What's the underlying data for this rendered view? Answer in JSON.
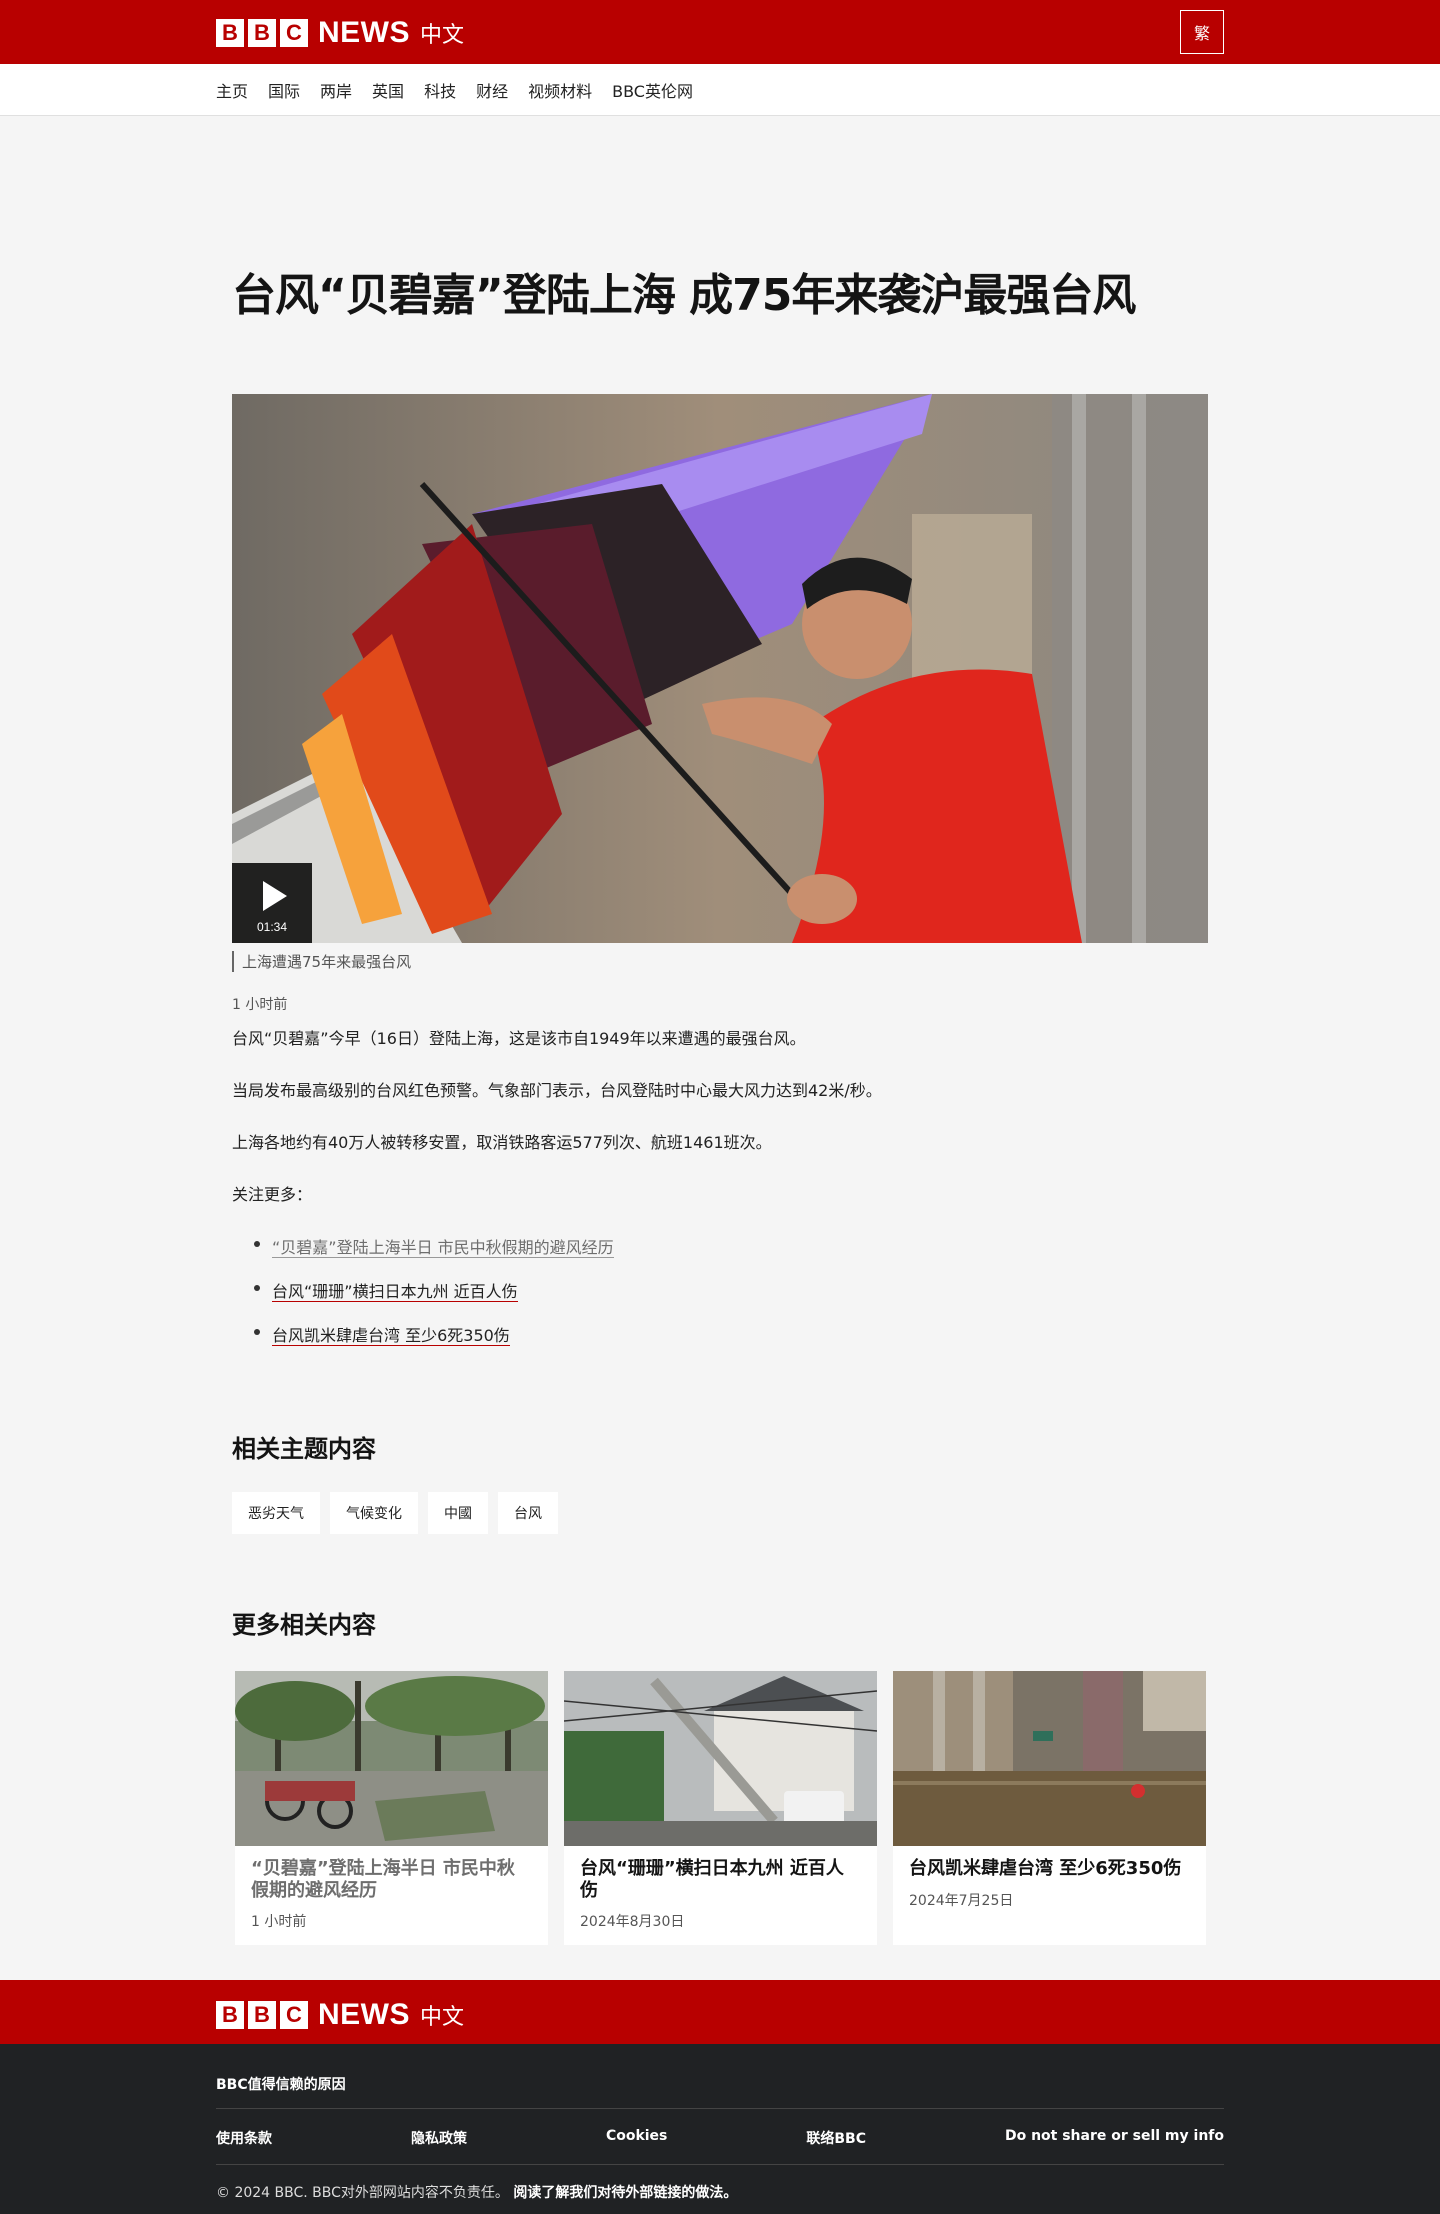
{
  "header": {
    "logo_letters": [
      "B",
      "B",
      "C"
    ],
    "logo_news": "NEWS",
    "logo_lang": "中文",
    "lang_switch": "繁"
  },
  "nav": {
    "items": [
      "主页",
      "国际",
      "两岸",
      "英国",
      "科技",
      "财经",
      "视频材料",
      "BBC英伦网"
    ]
  },
  "article": {
    "headline": "台风“贝碧嘉”登陆上海 成75年来袭沪最强台风",
    "video_duration": "01:34",
    "caption": "上海遭遇75年来最强台风",
    "timestamp": "1 小时前",
    "paragraphs": [
      "台风“贝碧嘉”今早（16日）登陆上海，这是该市自1949年以来遭遇的最强台风。",
      "当局发布最高级别的台风红色预警。气象部门表示，台风登陆时中心最大风力达到42米/秒。",
      "上海各地约有40万人被转移安置，取消铁路客运577列次、航班1461班次。",
      "关注更多："
    ],
    "related_links": [
      "“贝碧嘉”登陆上海半日 市民中秋假期的避风经历",
      "台风“珊珊”横扫日本九州 近百人伤",
      "台风凯米肆虐台湾 至少6死350伤"
    ]
  },
  "topics": {
    "title": "相关主题内容",
    "items": [
      "恶劣天气",
      "气候变化",
      "中國",
      "台风"
    ]
  },
  "more": {
    "title": "更多相关内容",
    "cards": [
      {
        "title": "“贝碧嘉”登陆上海半日 市民中秋假期的避风经历",
        "date": "1 小时前"
      },
      {
        "title": "台风“珊珊”横扫日本九州 近百人伤",
        "date": "2024年8月30日"
      },
      {
        "title": "台风凯米肆虐台湾 至少6死350伤",
        "date": "2024年7月25日"
      }
    ]
  },
  "footer": {
    "trust": "BBC值得信赖的原因",
    "links": [
      "使用条款",
      "隐私政策",
      "Cookies",
      "联络BBC",
      "Do not share or sell my info"
    ],
    "copyright": "© 2024 BBC. BBC对外部网站内容不负责任。",
    "external_link": "阅读了解我们对待外部链接的做法。"
  },
  "colors": {
    "brand_red": "#b80000",
    "footer_dark": "#202224",
    "page_bg": "#f5f5f5"
  }
}
